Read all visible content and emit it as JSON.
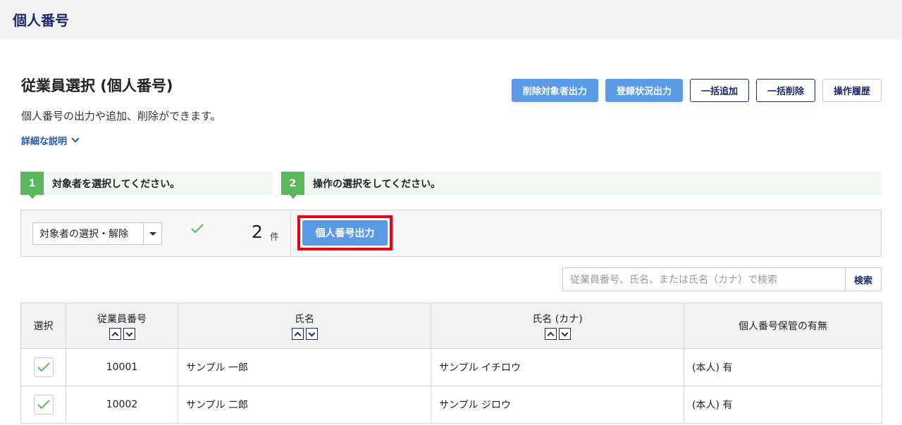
{
  "header": {
    "title": "個人番号"
  },
  "page": {
    "title": "従業員選択 (個人番号)",
    "description": "個人番号の出力や追加、削除ができます。",
    "detail_link": "詳細な説明"
  },
  "actions": {
    "delete_export": "削除対象者出力",
    "status_export": "登録状況出力",
    "bulk_add": "一括追加",
    "bulk_delete": "一括削除",
    "history": "操作履歴"
  },
  "steps": [
    {
      "num": "1",
      "text": "対象者を選択してください。"
    },
    {
      "num": "2",
      "text": "操作の選択をしてください。"
    }
  ],
  "operation": {
    "select_label": "対象者の選択・解除",
    "count": "2",
    "unit": "件",
    "export_button": "個人番号出力"
  },
  "search": {
    "placeholder": "従業員番号、氏名、または氏名（カナ）で検索",
    "button": "検索"
  },
  "table": {
    "headers": {
      "select": "選択",
      "emp_no": "従業員番号",
      "name": "氏名",
      "kana": "氏名 (カナ)",
      "has_number": "個人番号保管の有無"
    },
    "rows": [
      {
        "emp_no": "10001",
        "name": "サンプル 一郎",
        "kana": "サンプル イチロウ",
        "has_number": "(本人) 有"
      },
      {
        "emp_no": "10002",
        "name": "サンプル 二郎",
        "kana": "サンプル ジロウ",
        "has_number": "(本人) 有"
      }
    ]
  },
  "colors": {
    "accent": "#5b9be6",
    "navy": "#1b2a6b",
    "green": "#5cb85c",
    "highlight": "#e60012"
  }
}
